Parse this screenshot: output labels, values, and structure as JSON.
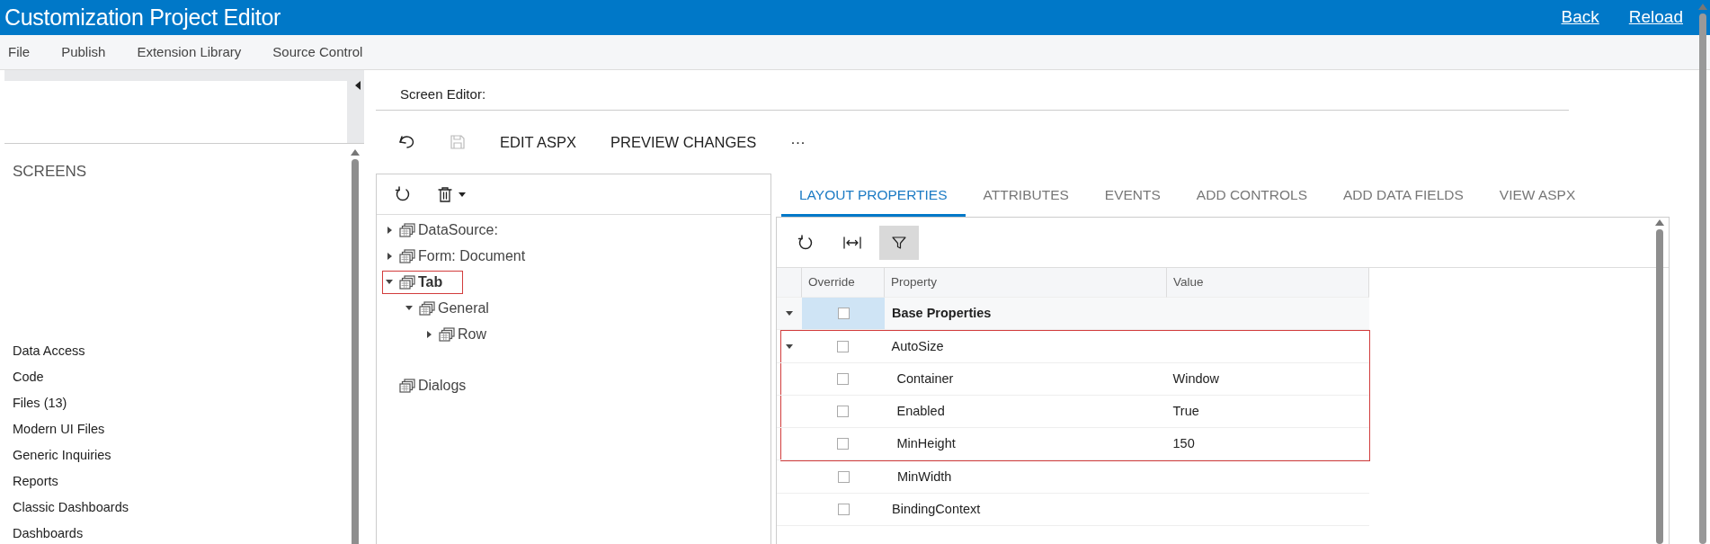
{
  "window": {
    "title": "Customization Project Editor",
    "links": [
      "Back",
      "Reload"
    ]
  },
  "menu": [
    "File",
    "Publish",
    "Extension Library",
    "Source Control"
  ],
  "sidebar": {
    "heading": "SCREENS",
    "items": [
      "Data Access",
      "Code",
      "Files (13)",
      "Modern UI Files",
      "Generic Inquiries",
      "Reports",
      "Classic Dashboards",
      "Dashboards"
    ]
  },
  "editor": {
    "label": "Screen Editor:",
    "toolbar": [
      {
        "kind": "undo",
        "disabled": false
      },
      {
        "kind": "save",
        "disabled": true
      },
      {
        "kind": "text",
        "label": "EDIT ASPX"
      },
      {
        "kind": "text",
        "label": "PREVIEW CHANGES"
      },
      {
        "kind": "text",
        "label": "···"
      }
    ]
  },
  "tree": {
    "items": [
      {
        "label": "DataSource:",
        "expanded": false,
        "selected": false,
        "highlighted": false
      },
      {
        "label": "Form: Document",
        "expanded": false,
        "selected": false,
        "highlighted": false
      },
      {
        "label": "Tab",
        "expanded": true,
        "selected": true,
        "highlighted": true,
        "children": [
          {
            "label": "General",
            "expanded": true,
            "selected": false,
            "highlighted": false,
            "children": [
              {
                "label": "Row",
                "expanded": false,
                "selected": false,
                "highlighted": false
              }
            ]
          }
        ]
      },
      {
        "label": "Dialogs",
        "selected": false,
        "highlighted": false
      }
    ]
  },
  "tabs": [
    {
      "label": "LAYOUT PROPERTIES",
      "selected": true
    },
    {
      "label": "ATTRIBUTES",
      "selected": false
    },
    {
      "label": "EVENTS",
      "selected": false
    },
    {
      "label": "ADD CONTROLS",
      "selected": false
    },
    {
      "label": "ADD DATA FIELDS",
      "selected": false
    },
    {
      "label": "VIEW ASPX",
      "selected": false
    }
  ],
  "grid": {
    "filter_on": true,
    "columns": [
      "Override",
      "Property",
      "Value"
    ],
    "rows": [
      {
        "property": "Base Properties",
        "kind": "group",
        "expanded": true,
        "checked": false,
        "selected": true,
        "highlighted": false,
        "children": [
          {
            "property": "AutoSize",
            "kind": "group",
            "expanded": true,
            "checked": false,
            "selected": false,
            "highlighted": true,
            "children": [
              {
                "property": "Container",
                "kind": "field",
                "value": "Window",
                "checked": false,
                "selected": false,
                "highlighted": true
              },
              {
                "property": "Enabled",
                "kind": "field",
                "value": "True",
                "checked": false,
                "selected": false,
                "highlighted": true
              },
              {
                "property": "MinHeight",
                "kind": "field",
                "value": "150",
                "checked": false,
                "selected": false,
                "highlighted": true
              },
              {
                "property": "MinWidth",
                "kind": "field",
                "checked": false,
                "selected": false,
                "highlighted": false
              }
            ]
          },
          {
            "property": "BindingContext",
            "kind": "field",
            "checked": false,
            "selected": false,
            "highlighted": false
          }
        ]
      }
    ]
  }
}
